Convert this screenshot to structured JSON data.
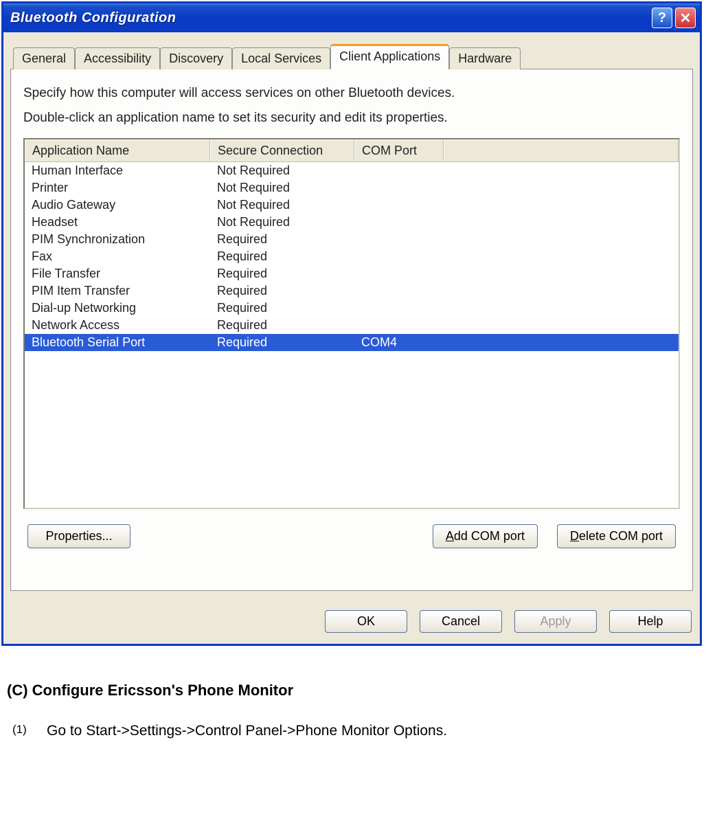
{
  "window": {
    "title": "Bluetooth Configuration"
  },
  "tabs": [
    {
      "label": "General"
    },
    {
      "label": "Accessibility"
    },
    {
      "label": "Discovery"
    },
    {
      "label": "Local Services"
    },
    {
      "label": "Client Applications",
      "active": true
    },
    {
      "label": "Hardware"
    }
  ],
  "panel": {
    "instruction1": "Specify how this computer will access services on other Bluetooth devices.",
    "instruction2": "Double-click an application name to set its security and edit its properties.",
    "columns": {
      "name": "Application Name",
      "secure": "Secure Connection",
      "port": "COM Port"
    },
    "rows": [
      {
        "name": "Human Interface",
        "secure": "Not Required",
        "port": ""
      },
      {
        "name": "Printer",
        "secure": "Not Required",
        "port": ""
      },
      {
        "name": "Audio Gateway",
        "secure": "Not Required",
        "port": ""
      },
      {
        "name": "Headset",
        "secure": "Not Required",
        "port": ""
      },
      {
        "name": "PIM Synchronization",
        "secure": "Required",
        "port": ""
      },
      {
        "name": "Fax",
        "secure": "Required",
        "port": ""
      },
      {
        "name": "File Transfer",
        "secure": "Required",
        "port": ""
      },
      {
        "name": "PIM Item Transfer",
        "secure": "Required",
        "port": ""
      },
      {
        "name": "Dial-up Networking",
        "secure": "Required",
        "port": ""
      },
      {
        "name": "Network Access",
        "secure": "Required",
        "port": ""
      },
      {
        "name": "Bluetooth Serial Port",
        "secure": "Required",
        "port": "COM4",
        "selected": true
      }
    ],
    "buttons": {
      "properties": "Properties...",
      "add_port_prefix": "A",
      "add_port_rest": "dd COM port",
      "del_port_prefix": "D",
      "del_port_rest": "elete COM port"
    }
  },
  "dialog_buttons": {
    "ok": "OK",
    "cancel": "Cancel",
    "apply": "Apply",
    "help": "Help"
  },
  "doc": {
    "heading": "(C) Configure Ericsson's Phone Monitor",
    "step_num": "(1)",
    "step_text": "Go to Start->Settings->Control Panel->Phone Monitor Options."
  }
}
